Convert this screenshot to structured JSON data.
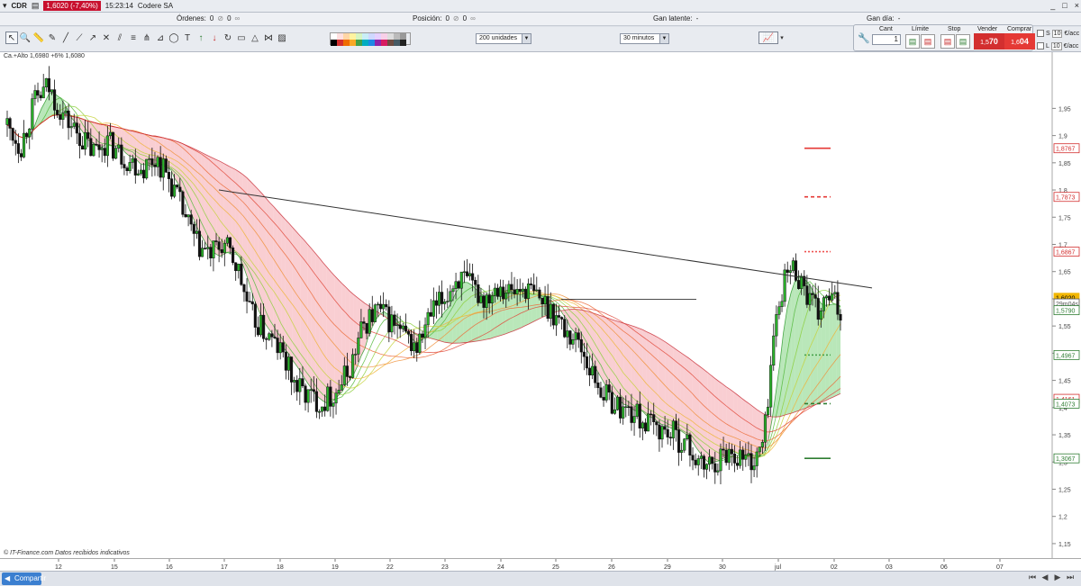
{
  "window": {
    "symbol": "CDR",
    "price_badge": "1,6020 (-7,40%)",
    "time": "15:23:14",
    "company": "Codere SA",
    "buttons": [
      "_",
      "□",
      "×"
    ]
  },
  "status": {
    "orders": {
      "label": "Órdenes:",
      "values": [
        "0",
        "0"
      ]
    },
    "position": {
      "label": "Posición:",
      "values": [
        "0",
        "0"
      ]
    },
    "latent": {
      "label": "Gan latente:",
      "value": "-"
    },
    "day": {
      "label": "Gan día:",
      "value": "-"
    }
  },
  "toolbar": {
    "units_select": "200 unidades",
    "interval_select": "30 minutos",
    "icons": [
      "cursor-icon",
      "zoom-icon",
      "measure-icon",
      "pencil-icon",
      "line-icon",
      "extended-line-icon",
      "ray-icon",
      "cross-icon",
      "channel-icon",
      "fibonacci-icon",
      "andrews-icon",
      "gann-icon",
      "ellipse-icon",
      "text-icon",
      "arrow-up-icon",
      "arrow-down-icon",
      "rotate-icon",
      "rectangle-icon",
      "triangle-icon",
      "pattern-icon",
      "fill-icon"
    ]
  },
  "trade": {
    "qty_label": "Cant",
    "qty_value": "1",
    "limit_label": "Límite",
    "stop_label": "Stop",
    "sell_label": "Vender",
    "sell_price_small": "1,5",
    "sell_price_big": "70",
    "buy_label": "Comprar",
    "buy_price_small": "1,6",
    "buy_price_big": "04",
    "s_label": "S",
    "s_qty": "10",
    "s_unit": "€/acc",
    "l_label": "L",
    "l_qty": "10",
    "l_unit": "€/acc",
    "sell_color": "#d32f2f",
    "buy_color": "#e53935"
  },
  "chart_data": {
    "type": "candlestick",
    "title": "",
    "overlay_text": "Ca.+Alto 1,6980 +6%   1,6080",
    "footer": "© IT-Finance.com  Datos recibidos indicativos",
    "ylim": [
      1.13,
      2.04
    ],
    "y_ticks": [
      "1,95",
      "1,9",
      "1,85",
      "1,8",
      "1,75",
      "1,7",
      "1,65",
      "1,6",
      "1,55",
      "1,5",
      "1,45",
      "1,4",
      "1,35",
      "1,3",
      "1,25",
      "1,2",
      "1,15"
    ],
    "x_ticks": [
      "12",
      "15",
      "16",
      "17",
      "18",
      "19",
      "22",
      "23",
      "24",
      "25",
      "26",
      "29",
      "30",
      "jul",
      "02",
      "03",
      "06",
      "07"
    ],
    "price_labels": [
      {
        "text": "1,8767",
        "value": 1.8767,
        "color": "#d32f2f"
      },
      {
        "text": "1,7873",
        "value": 1.7873,
        "color": "#d32f2f"
      },
      {
        "text": "1,6867",
        "value": 1.6867,
        "color": "#d32f2f"
      },
      {
        "text": "1,6020",
        "value": 1.602,
        "color": "#f2b705"
      },
      {
        "text": "29m04s",
        "value": 1.5915,
        "color": "#555555"
      },
      {
        "text": "1,5790",
        "value": 1.579,
        "color": "#2e7d32"
      },
      {
        "text": "1,4967",
        "value": 1.4967,
        "color": "#2e7d32"
      },
      {
        "text": "1,4161",
        "value": 1.4161,
        "color": "#d32f2f"
      },
      {
        "text": "1,4073",
        "value": 1.4073,
        "color": "#2e7d32"
      },
      {
        "text": "1,3067",
        "value": 1.3067,
        "color": "#2e7d32"
      }
    ],
    "levels": [
      {
        "value": 1.8767,
        "style": "solid",
        "color": "#e53935"
      },
      {
        "value": 1.7873,
        "style": "dashed",
        "color": "#e53935"
      },
      {
        "value": 1.6867,
        "style": "dotted",
        "color": "#ef5350"
      },
      {
        "value": 1.4967,
        "style": "dotted",
        "color": "#43a047"
      },
      {
        "value": 1.4073,
        "style": "dashed",
        "color": "#2e7d32"
      },
      {
        "value": 1.3067,
        "style": "solid",
        "color": "#2e7d32"
      }
    ],
    "trendline": {
      "from": [
        4.7,
        1.8
      ],
      "to": [
        19.2,
        1.62
      ]
    },
    "horizontal_line": {
      "value": 1.599,
      "from": 12.3,
      "to": 15.3
    },
    "price_path": [
      [
        0.0,
        1.92
      ],
      [
        0.3,
        1.88
      ],
      [
        0.6,
        1.96
      ],
      [
        0.9,
        1.99
      ],
      [
        1.3,
        1.93
      ],
      [
        1.6,
        1.9
      ],
      [
        1.9,
        1.87
      ],
      [
        2.2,
        1.89
      ],
      [
        2.6,
        1.86
      ],
      [
        3.0,
        1.84
      ],
      [
        3.3,
        1.86
      ],
      [
        3.6,
        1.82
      ],
      [
        3.9,
        1.76
      ],
      [
        4.2,
        1.7
      ],
      [
        4.5,
        1.68
      ],
      [
        4.8,
        1.7
      ],
      [
        5.1,
        1.66
      ],
      [
        5.4,
        1.57
      ],
      [
        5.7,
        1.54
      ],
      [
        6.1,
        1.5
      ],
      [
        6.4,
        1.44
      ],
      [
        6.7,
        1.42
      ],
      [
        7.0,
        1.41
      ],
      [
        7.3,
        1.43
      ],
      [
        7.6,
        1.47
      ],
      [
        7.9,
        1.55
      ],
      [
        8.2,
        1.58
      ],
      [
        8.5,
        1.56
      ],
      [
        8.8,
        1.53
      ],
      [
        9.1,
        1.51
      ],
      [
        9.4,
        1.57
      ],
      [
        9.7,
        1.6
      ],
      [
        10.0,
        1.64
      ],
      [
        10.3,
        1.62
      ],
      [
        10.6,
        1.6
      ],
      [
        10.9,
        1.63
      ],
      [
        11.2,
        1.61
      ],
      [
        11.5,
        1.62
      ],
      [
        11.8,
        1.6
      ],
      [
        12.1,
        1.58
      ],
      [
        12.4,
        1.54
      ],
      [
        12.7,
        1.52
      ],
      [
        13.0,
        1.46
      ],
      [
        13.3,
        1.42
      ],
      [
        13.6,
        1.4
      ],
      [
        13.9,
        1.39
      ],
      [
        14.2,
        1.37
      ],
      [
        14.5,
        1.36
      ],
      [
        14.8,
        1.35
      ],
      [
        15.1,
        1.33
      ],
      [
        15.4,
        1.29
      ],
      [
        15.7,
        1.3
      ],
      [
        16.0,
        1.32
      ],
      [
        16.3,
        1.31
      ],
      [
        16.6,
        1.3
      ],
      [
        16.8,
        1.34
      ],
      [
        17.0,
        1.52
      ],
      [
        17.2,
        1.62
      ],
      [
        17.4,
        1.66
      ],
      [
        17.6,
        1.64
      ],
      [
        17.8,
        1.6
      ],
      [
        18.0,
        1.57
      ],
      [
        18.2,
        1.6
      ],
      [
        18.4,
        1.59
      ],
      [
        18.5,
        1.57
      ]
    ],
    "indicator": {
      "name": "moving-average ribbon",
      "bull_color": "#7fd47f",
      "bear_color": "#f4a6ad"
    },
    "grid": false
  }
}
